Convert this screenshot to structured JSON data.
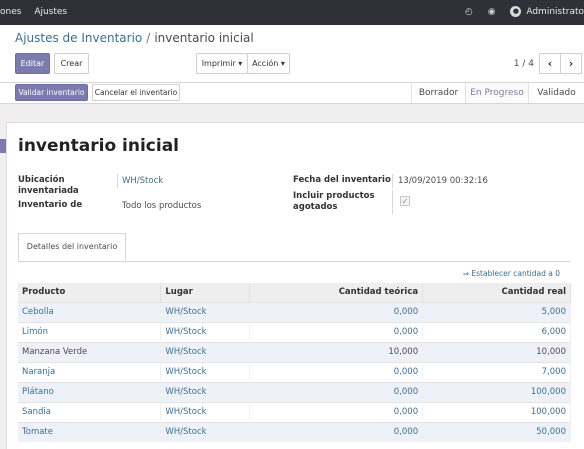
{
  "topbar": {
    "nav": [
      "ones",
      "Ajustes"
    ],
    "user": "Administrato"
  },
  "breadcrumb": {
    "parent": "Ajustes de Inventario",
    "separator": "/",
    "current": "inventario inicial"
  },
  "toolbar": {
    "edit_label": "Editar",
    "create_label": "Crear",
    "print_label": "Imprimir ▾",
    "action_label": "Acción ▾",
    "pager": "1 / 4",
    "prev_label": "‹",
    "next_label": "›"
  },
  "statusbar": {
    "validate_label": "Validar inventario",
    "cancel_label": "Cancelar el inventario",
    "stages": [
      "Borrador",
      "En Progreso",
      "Validado"
    ],
    "active_stage": "En Progreso"
  },
  "form": {
    "title": "inventario inicial",
    "location_label": "Ubicación inventariada",
    "location_value": "WH/Stock",
    "inventory_of_label": "Inventario de",
    "inventory_of_value": "Todo los productos",
    "date_label": "Fecha del inventario",
    "date_value": "13/09/2019 00:32:16",
    "include_exhausted_label": "Incluir productos agotados",
    "include_exhausted_checked": true
  },
  "tabs": {
    "details_label": "Detalles del inventario",
    "set_zero_label": "⇒ Establecer cantidad a 0"
  },
  "table": {
    "headers": [
      "Producto",
      "Lugar",
      "Cantidad teórica",
      "Cantidad real"
    ],
    "rows": [
      {
        "product": "Cebolla",
        "location": "WH/Stock",
        "theoretical": "0,000",
        "real": "5,000"
      },
      {
        "product": "Limón",
        "location": "WH/Stock",
        "theoretical": "0,000",
        "real": "6,000"
      },
      {
        "product": "Manzana Verde",
        "location": "WH/Stock",
        "theoretical": "10,000",
        "real": "10,000"
      },
      {
        "product": "Naranja",
        "location": "WH/Stock",
        "theoretical": "0,000",
        "real": "7,000"
      },
      {
        "product": "Plátano",
        "location": "WH/Stock",
        "theoretical": "0,000",
        "real": "100,000"
      },
      {
        "product": "Sandia",
        "location": "WH/Stock",
        "theoretical": "0,000",
        "real": "100,000"
      },
      {
        "product": "Tomate",
        "location": "WH/Stock",
        "theoretical": "0,000",
        "real": "50,000"
      }
    ]
  },
  "colors": {
    "primary": "#7c7bad",
    "link": "#3f6d8f",
    "topbar": "#2f3136"
  },
  "icons": [
    "clock-icon",
    "chat-icon",
    "avatar-icon",
    "checkbox-check-icon"
  ]
}
